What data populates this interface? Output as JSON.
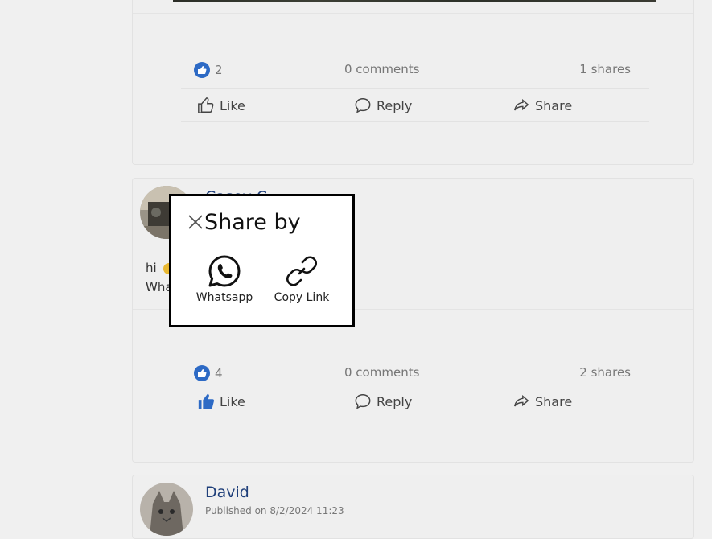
{
  "posts": [
    {
      "likes": "2",
      "comments": "0 comments",
      "shares": "1 shares",
      "actions": {
        "like": "Like",
        "reply": "Reply",
        "share": "Share"
      }
    },
    {
      "author": "Casey C",
      "text_line1": "hi",
      "text_line2": "Wha",
      "likes": "4",
      "comments": "0 comments",
      "shares": "2 shares",
      "actions": {
        "like": "Like",
        "reply": "Reply",
        "share": "Share"
      }
    },
    {
      "author": "David",
      "published": "Published on 8/2/2024 11:23"
    }
  ],
  "share_modal": {
    "title": "Share by",
    "options": [
      {
        "label": "Whatsapp",
        "icon": "whatsapp-icon"
      },
      {
        "label": "Copy Link",
        "icon": "link-icon"
      }
    ]
  },
  "colors": {
    "like_blue": "#2d6ac5",
    "author_blue": "#1f3f7a"
  }
}
